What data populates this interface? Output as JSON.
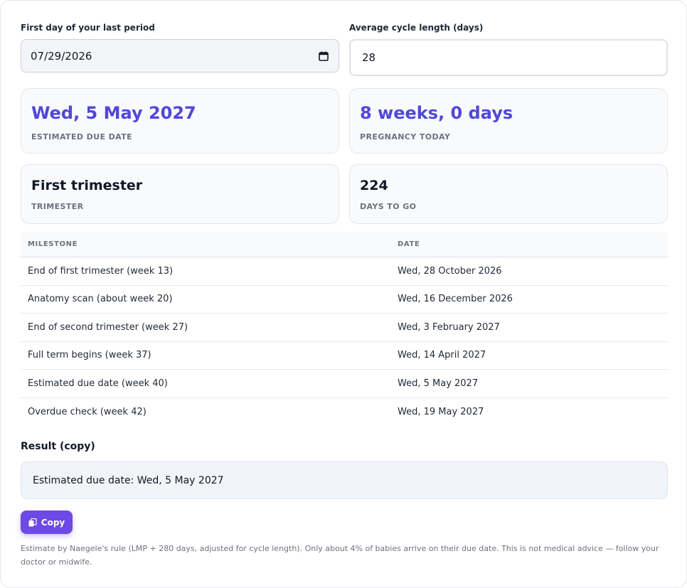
{
  "inputs": {
    "lmp_label": "First day of your last period",
    "lmp_value": "07/29/2026",
    "cycle_label": "Average cycle length (days)",
    "cycle_value": "28"
  },
  "stats": {
    "due_date": {
      "value": "Wed, 5 May 2027",
      "caption": "ESTIMATED DUE DATE"
    },
    "pregnancy_today": {
      "value": "8 weeks, 0 days",
      "caption": "PREGNANCY TODAY"
    },
    "trimester": {
      "value": "First trimester",
      "caption": "TRIMESTER"
    },
    "days_to_go": {
      "value": "224",
      "caption": "DAYS TO GO"
    }
  },
  "milestones": {
    "headers": [
      "MILESTONE",
      "DATE"
    ],
    "rows": [
      {
        "milestone": "End of first trimester (week 13)",
        "date": "Wed, 28 October 2026"
      },
      {
        "milestone": "Anatomy scan (about week 20)",
        "date": "Wed, 16 December 2026"
      },
      {
        "milestone": "End of second trimester (week 27)",
        "date": "Wed, 3 February 2027"
      },
      {
        "milestone": "Full term begins (week 37)",
        "date": "Wed, 14 April 2027"
      },
      {
        "milestone": "Estimated due date (week 40)",
        "date": "Wed, 5 May 2027"
      },
      {
        "milestone": "Overdue check (week 42)",
        "date": "Wed, 19 May 2027"
      }
    ]
  },
  "result": {
    "label": "Result (copy)",
    "text": "Estimated due date: Wed, 5 May 2027",
    "copy_label": "Copy"
  },
  "footnote": "Estimate by Naegele's rule (LMP + 280 days, adjusted for cycle length). Only about 4% of babies arrive on their due date. This is not medical advice — follow your doctor or midwife.",
  "colors": {
    "accent": "#4f46e5",
    "button": "#6d4ae8",
    "muted": "#6b7280"
  },
  "icons": {
    "date_picker": "calendar-icon",
    "copy": "copy-icon"
  }
}
